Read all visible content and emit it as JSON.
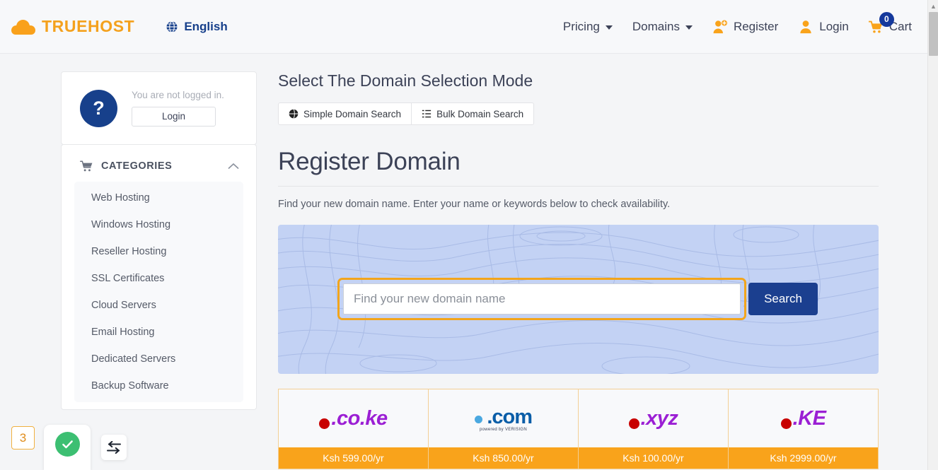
{
  "header": {
    "logo_text": "TRUEHOST",
    "logo_icon": "cloud-icon",
    "language": "English",
    "language_icon": "globe-icon",
    "nav": [
      {
        "label": "Pricing",
        "icon": "chevron-down-icon"
      },
      {
        "label": "Domains",
        "icon": "chevron-down-icon"
      }
    ],
    "register_label": "Register",
    "register_icon": "user-plus-icon",
    "login_label": "Login",
    "login_icon": "user-icon",
    "cart_label": "Cart",
    "cart_icon": "shopping-cart-icon",
    "cart_count": "0",
    "cart_badge_color": "#15399c",
    "brand_color": "#f4a11d",
    "accent_blue": "#17408b"
  },
  "sidebar": {
    "login_panel": {
      "icon": "question-mark-icon",
      "status_text": "You are not logged in.",
      "login_button": "Login"
    },
    "categories": {
      "title": "CATEGORIES",
      "icon": "shopping-cart-icon",
      "collapse_icon": "chevron-up-icon",
      "items": [
        {
          "label": "Web Hosting"
        },
        {
          "label": "Windows Hosting"
        },
        {
          "label": "Reseller Hosting"
        },
        {
          "label": "SSL Certificates"
        },
        {
          "label": "Cloud Servers"
        },
        {
          "label": "Email Hosting"
        },
        {
          "label": "Dedicated Servers"
        },
        {
          "label": "Backup Software"
        }
      ]
    }
  },
  "main": {
    "mode_title": "Select The Domain Selection Mode",
    "mode_tabs": [
      {
        "label": "Simple Domain Search",
        "icon": "globe-icon",
        "active": true
      },
      {
        "label": "Bulk Domain Search",
        "icon": "list-icon",
        "active": false
      }
    ],
    "page_title": "Register Domain",
    "subtitle": "Find your new domain name. Enter your name or keywords below to check availability.",
    "search": {
      "placeholder": "Find your new domain name",
      "value": "",
      "button_label": "Search",
      "button_color": "#1b3f8f",
      "focus_ring_color": "#f2a51c",
      "banner_color": "#c3d2f4"
    },
    "tlds": [
      {
        "name": ".co.ke",
        "price": "Ksh 599.00/yr",
        "text_color": "#9b1fd4",
        "dot_color": "#c80000",
        "tagline": ""
      },
      {
        "name": ".com",
        "price": "Ksh 850.00/yr",
        "text_color": "#0b5ea8",
        "dot_color": "#4aa8e0",
        "tagline": "powered by VERISIGN"
      },
      {
        "name": ".xyz",
        "price": "Ksh 100.00/yr",
        "text_color": "#9b1fd4",
        "dot_color": "#c80000",
        "tagline": ""
      },
      {
        "name": ".KE",
        "price": "Ksh 2999.00/yr",
        "text_color": "#9b1fd4",
        "dot_color": "#c80000",
        "tagline": ""
      }
    ],
    "price_bar_color": "#f9a31b"
  },
  "overlays": {
    "step_badge": "3",
    "check_icon": "check-circle-icon",
    "check_color": "#3cbf72",
    "swap_icon": "swap-arrows-icon"
  },
  "scrollbar": {
    "up_icon": "chevron-up-icon"
  }
}
